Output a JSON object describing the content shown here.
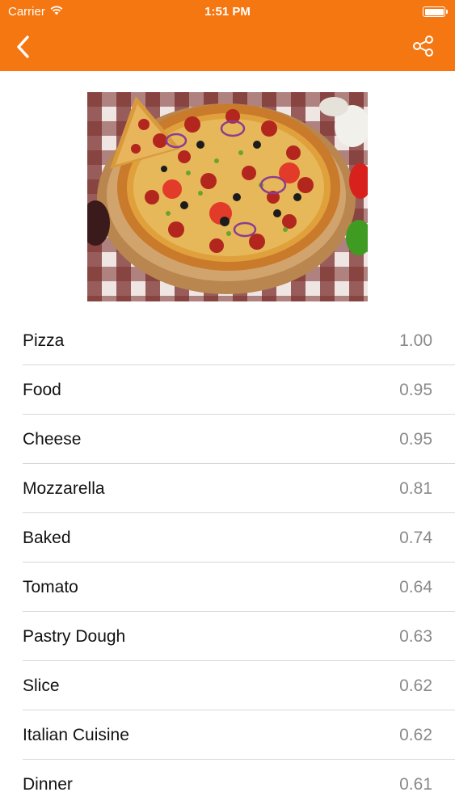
{
  "status_bar": {
    "carrier": "Carrier",
    "time": "1:51 PM"
  },
  "colors": {
    "accent": "#f57711",
    "divider": "#d8d8d8",
    "score_text": "#8a8a8a"
  },
  "nav": {
    "back_icon": "chevron-left-icon",
    "share_icon": "share-icon"
  },
  "tags": [
    {
      "label": "Pizza",
      "score": "1.00"
    },
    {
      "label": "Food",
      "score": "0.95"
    },
    {
      "label": "Cheese",
      "score": "0.95"
    },
    {
      "label": "Mozzarella",
      "score": "0.81"
    },
    {
      "label": "Baked",
      "score": "0.74"
    },
    {
      "label": "Tomato",
      "score": "0.64"
    },
    {
      "label": "Pastry Dough",
      "score": "0.63"
    },
    {
      "label": "Slice",
      "score": "0.62"
    },
    {
      "label": "Italian Cuisine",
      "score": "0.62"
    },
    {
      "label": "Dinner",
      "score": "0.61"
    }
  ]
}
